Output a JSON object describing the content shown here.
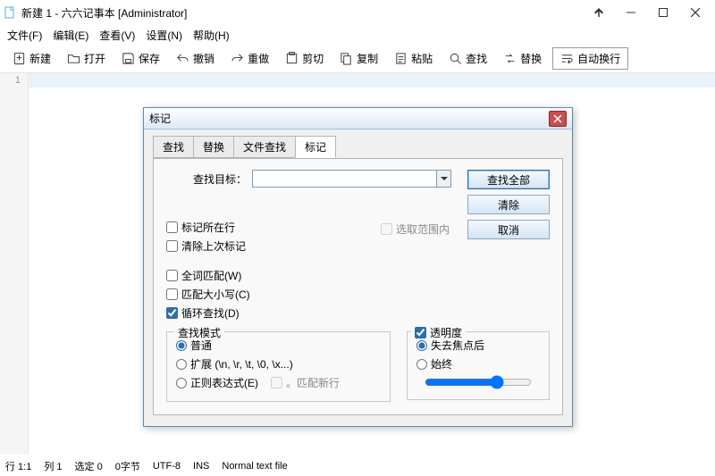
{
  "window": {
    "title": "新建 1 - 六六记事本 [Administrator]"
  },
  "menubar": {
    "file": "文件(F)",
    "edit": "编辑(E)",
    "view": "查看(V)",
    "settings": "设置(N)",
    "help": "帮助(H)"
  },
  "toolbar": {
    "new": "新建",
    "open": "打开",
    "save": "保存",
    "undo": "撤销",
    "redo": "重做",
    "cut": "剪切",
    "copy": "复制",
    "paste": "粘贴",
    "find": "查找",
    "replace": "替换",
    "wrap": "自动换行"
  },
  "editor": {
    "line1_no": "1"
  },
  "status": {
    "line": "行 1:1",
    "col": "列 1",
    "sel": "选定 0",
    "bytes": "0字节",
    "enc": "UTF-8",
    "ins": "INS",
    "filetype": "Normal text file"
  },
  "dialog": {
    "title": "标记",
    "tabs": {
      "find": "查找",
      "replace": "替换",
      "files": "文件查找",
      "mark": "标记"
    },
    "target_label": "查找目标：",
    "btn_findall": "查找全部",
    "btn_clear": "清除",
    "btn_cancel": "取消",
    "opt_markline": "标记所在行",
    "opt_clearlast": "清除上次标记",
    "opt_inselection": "选取范围内",
    "opt_wholeword": "全词匹配(W)",
    "opt_case": "匹配大小写(C)",
    "opt_wrap": "循环查找(D)",
    "group_mode": "查找模式",
    "mode_normal": "普通",
    "mode_ext": "扩展 (\\n, \\r, \\t, \\0, \\x...)",
    "mode_regex": "正则表达式(E)",
    "mode_newline": "。匹配新行",
    "group_trans": "透明度",
    "trans_onlose": "失去焦点后",
    "trans_always": "始终"
  }
}
